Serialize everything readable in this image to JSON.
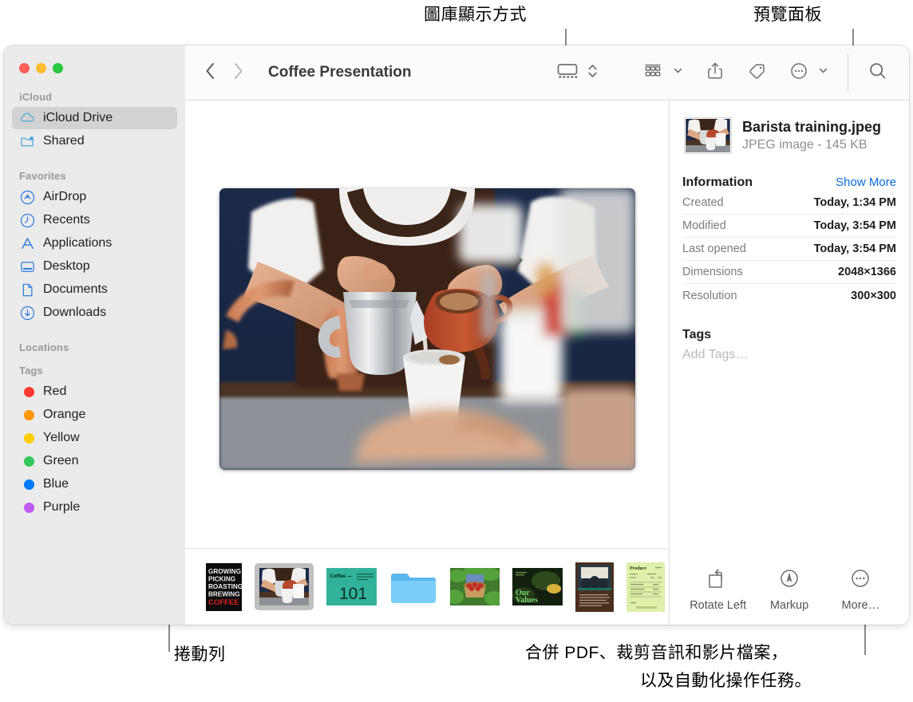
{
  "annotations": {
    "gallery_view": "圖庫顯示方式",
    "preview_panel": "預覽面板",
    "filmstrip": "捲動列",
    "more_actions_line1": "合併 PDF、裁剪音訊和影片檔案，",
    "more_actions_line2": "以及自動化操作任務。"
  },
  "window": {
    "traffic_lights": [
      "close-button",
      "minimize-button",
      "zoom-button"
    ],
    "title": "Coffee Presentation"
  },
  "sidebar": {
    "sections": [
      {
        "label": "iCloud",
        "items": [
          {
            "label": "iCloud Drive",
            "icon": "cloud-icon",
            "selected": true
          },
          {
            "label": "Shared",
            "icon": "shared-folder-icon",
            "selected": false
          }
        ]
      },
      {
        "label": "Favorites",
        "items": [
          {
            "label": "AirDrop",
            "icon": "airdrop-icon",
            "selected": false
          },
          {
            "label": "Recents",
            "icon": "clock-icon",
            "selected": false
          },
          {
            "label": "Applications",
            "icon": "applications-icon",
            "selected": false
          },
          {
            "label": "Desktop",
            "icon": "desktop-icon",
            "selected": false
          },
          {
            "label": "Documents",
            "icon": "document-icon",
            "selected": false
          },
          {
            "label": "Downloads",
            "icon": "download-icon",
            "selected": false
          }
        ]
      },
      {
        "label": "Locations",
        "items": []
      },
      {
        "label": "Tags",
        "items": [
          {
            "label": "Red",
            "icon": "tag-dot-icon",
            "color": "#ff3b30"
          },
          {
            "label": "Orange",
            "icon": "tag-dot-icon",
            "color": "#ff9500"
          },
          {
            "label": "Yellow",
            "icon": "tag-dot-icon",
            "color": "#ffcc00"
          },
          {
            "label": "Green",
            "icon": "tag-dot-icon",
            "color": "#34c759"
          },
          {
            "label": "Blue",
            "icon": "tag-dot-icon",
            "color": "#007aff"
          },
          {
            "label": "Purple",
            "icon": "tag-dot-icon",
            "color": "#bf5af2"
          }
        ]
      }
    ]
  },
  "toolbar": {
    "back": "back-icon",
    "forward": "forward-icon",
    "view_gallery": "gallery-view-icon",
    "view_stepper": "stepper-icon",
    "group_by": "group-by-icon",
    "share": "share-icon",
    "tag": "tag-icon",
    "more": "more-ellipsis-icon",
    "search": "search-icon"
  },
  "preview": {
    "file_name": "Barista training.jpeg",
    "file_kind": "JPEG image - 145 KB",
    "information_title": "Information",
    "show_more": "Show More",
    "info_rows": [
      {
        "key": "Created",
        "value": "Today, 1:34 PM"
      },
      {
        "key": "Modified",
        "value": "Today, 3:54 PM"
      },
      {
        "key": "Last opened",
        "value": "Today, 3:54 PM"
      },
      {
        "key": "Dimensions",
        "value": "2048×1366"
      },
      {
        "key": "Resolution",
        "value": "300×300"
      }
    ],
    "tags_title": "Tags",
    "tags_placeholder": "Add Tags…",
    "actions": [
      {
        "label": "Rotate Left",
        "icon": "rotate-left-icon"
      },
      {
        "label": "Markup",
        "icon": "markup-icon"
      },
      {
        "label": "More…",
        "icon": "more-ellipsis-icon"
      }
    ]
  },
  "filmstrip": {
    "items": [
      {
        "name": "growing-picking-roasting-brewing-coffee-slide",
        "kind": "poster",
        "lines": [
          "GROWING",
          "PICKING",
          "ROASTING",
          "BREWING"
        ],
        "accent_line": "COFFEE",
        "selected": false
      },
      {
        "name": "barista-training-photo",
        "kind": "photo",
        "selected": true
      },
      {
        "name": "coffee-101-slide",
        "kind": "slide",
        "heading": "Coffee —",
        "big_text": "101",
        "selected": false
      },
      {
        "name": "folder",
        "kind": "folder",
        "selected": false
      },
      {
        "name": "coffee-berries-photo",
        "kind": "photo",
        "selected": false
      },
      {
        "name": "our-values-slide",
        "kind": "slide",
        "big_text": "Our\nValues",
        "selected": false
      },
      {
        "name": "meeting-photo-document",
        "kind": "document",
        "selected": false
      },
      {
        "name": "green-receipt-document",
        "kind": "document",
        "heading": "Produce",
        "selected": false
      }
    ]
  },
  "colors": {
    "accent_link": "#0a69da",
    "sidebar_bg": "#ebebeb",
    "selected_row": "#d2d2d2",
    "toolbar_bg": "#fbfbfb"
  }
}
